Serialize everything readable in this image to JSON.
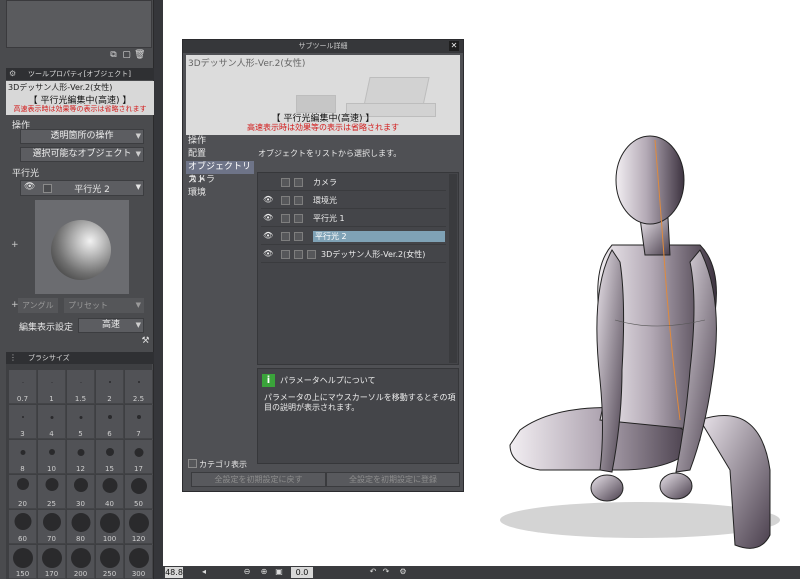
{
  "tool_property": {
    "title": "ツールプロパティ[オブジェクト]",
    "object_name": "3Dデッサン人形-Ver.2(女性)",
    "mode_title": "【 平行光編集中(高速) 】",
    "warning": "高速表示時は効果等の表示は省略されます",
    "operation_label": "操作",
    "transparent_op": "透明箇所の操作",
    "selectable_objects": "選択可能なオブジェクト",
    "parallel_light_label": "平行光",
    "light_name": "平行光 2",
    "angle_label": "アングル",
    "preset_label": "プリセット",
    "display_setting_label": "編集表示設定",
    "display_setting_value": "高速"
  },
  "brush_size": {
    "title": "ブラシサイズ",
    "sizes": [
      "0.7",
      "1",
      "1.5",
      "2",
      "2.5",
      "3",
      "4",
      "5",
      "6",
      "7",
      "8",
      "10",
      "12",
      "15",
      "17",
      "20",
      "25",
      "30",
      "40",
      "50",
      "60",
      "70",
      "80",
      "100",
      "120",
      "150",
      "170",
      "200",
      "250",
      "300"
    ],
    "dot_sizes": [
      1,
      1,
      1,
      2,
      2,
      2,
      3,
      3,
      4,
      4,
      5,
      6,
      7,
      8,
      9,
      12,
      13,
      14,
      15,
      16,
      17,
      18,
      19,
      20,
      20,
      20,
      20,
      20,
      20,
      20
    ]
  },
  "dialog": {
    "title": "サブツール詳細",
    "preview_name": "3Dデッサン人形-Ver.2(女性)",
    "preview_mode": "【 平行光編集中(高速) 】",
    "preview_warning": "高速表示時は効果等の表示は省略されます",
    "categories": [
      {
        "label": "操作",
        "selected": false
      },
      {
        "label": "配置",
        "selected": false
      },
      {
        "label": "オブジェクトリスト",
        "selected": true
      },
      {
        "label": "カメラ",
        "selected": false
      },
      {
        "label": "環境",
        "selected": false
      }
    ],
    "description": "オブジェクトをリストから選択します。",
    "objects": [
      {
        "name": "カメラ",
        "eye": false,
        "selected": false,
        "third_box": false
      },
      {
        "name": "環境光",
        "eye": true,
        "selected": false,
        "third_box": false
      },
      {
        "name": "平行光 1",
        "eye": true,
        "selected": false,
        "third_box": false
      },
      {
        "name": "平行光 2",
        "eye": true,
        "selected": true,
        "third_box": false
      },
      {
        "name": "3Dデッサン人形-Ver.2(女性)",
        "eye": true,
        "selected": false,
        "third_box": true
      }
    ],
    "help_title": "パラメータヘルプについて",
    "help_text": "パラメータの上にマウスカーソルを移動するとその項目の説明が表示されます。",
    "show_category": "カテゴリ表示",
    "reset_button": "全設定を初期設定に戻す",
    "register_button": "全設定を初期設定に登録"
  },
  "status_bar": {
    "zoom": "48.8",
    "angle": "0.0"
  },
  "colors": {
    "panel_bg": "#4a4b4e",
    "warning_red": "#d21c1c",
    "selected_category": "#6e7488",
    "selected_object": "#7fa2b6"
  }
}
